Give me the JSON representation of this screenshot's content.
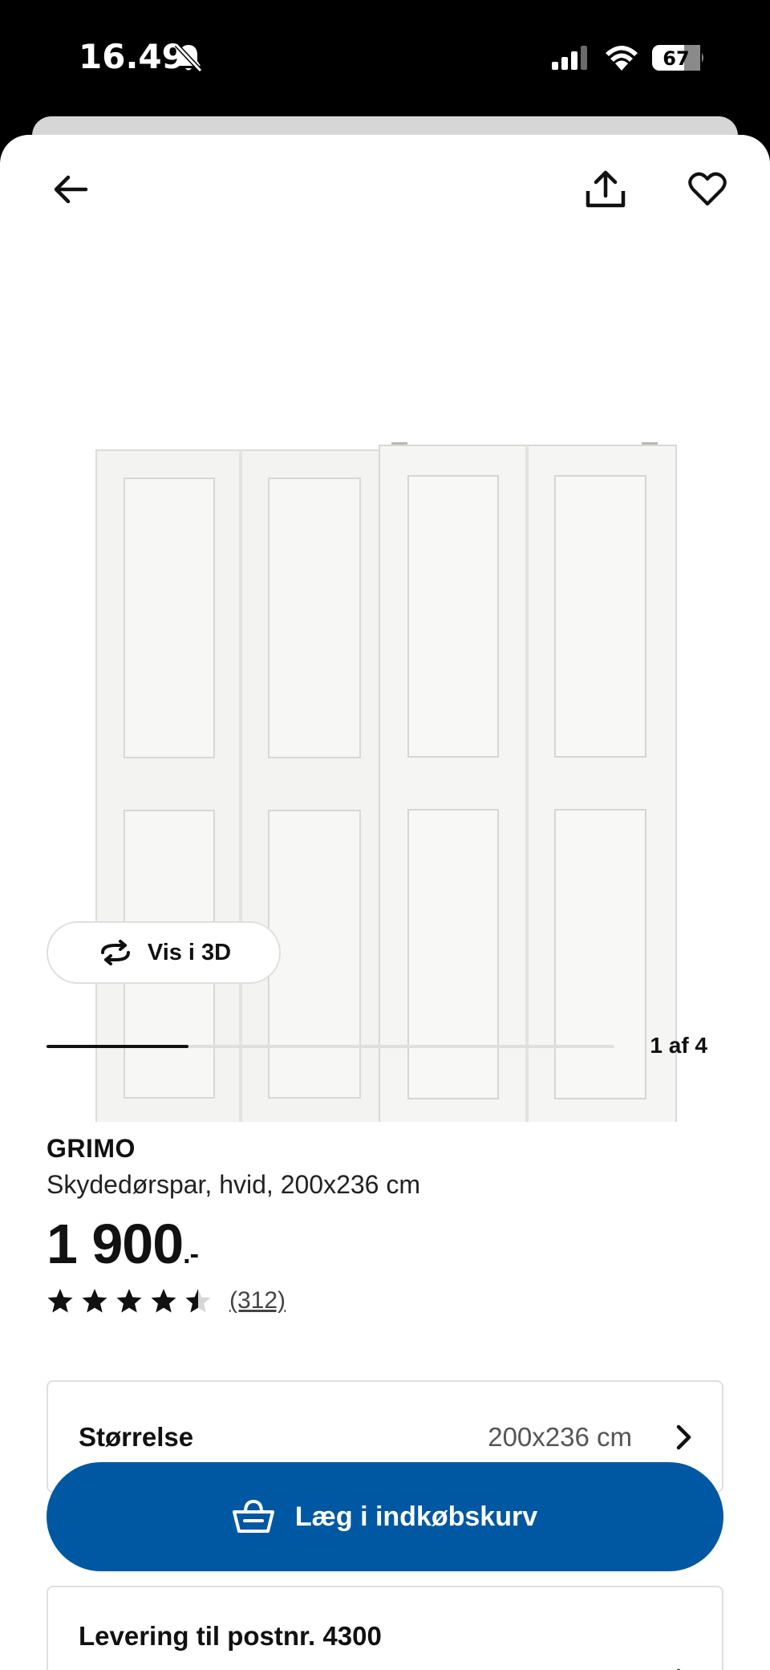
{
  "status_bar": {
    "time": "16.49",
    "battery": "67",
    "icons": [
      "bell-muted-icon",
      "cellular-signal-icon",
      "wifi-icon",
      "battery-icon"
    ]
  },
  "nav": {
    "icons": [
      "arrow-left-icon",
      "share-icon",
      "heart-icon"
    ]
  },
  "gallery": {
    "view_3d_label": "Vis i 3D",
    "view_3d_icon": "rotate-3d-icon",
    "counter": "1 af 4",
    "progress": 0.25
  },
  "product": {
    "name": "GRIMO",
    "description": "Skydedørspar, hvid, 200x236 cm",
    "price": "1 900",
    "price_suffix": ".-",
    "rating": 4.5,
    "review_count": "(312)"
  },
  "size": {
    "label": "Størrelse",
    "value": "200x236 cm"
  },
  "cart": {
    "label": "Læg i indkøbskurv",
    "icon": "basket-icon",
    "color": "#0058a3"
  },
  "delivery": {
    "label": "Levering til postnr. 4300"
  }
}
